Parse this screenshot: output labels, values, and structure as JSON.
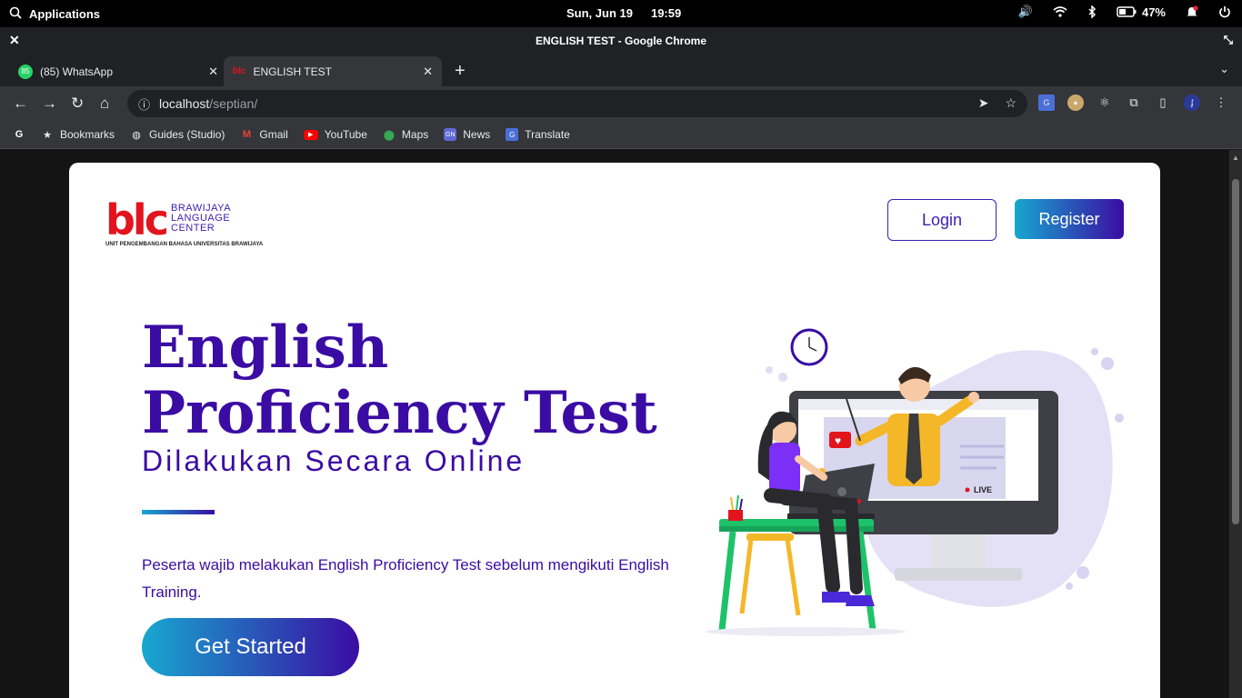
{
  "system_bar": {
    "applications": "Applications",
    "date": "Sun, Jun 19",
    "time": "19:59",
    "battery": "47%"
  },
  "window": {
    "title": "ENGLISH TEST - Google Chrome"
  },
  "tabs": [
    {
      "label": "(85) WhatsApp",
      "badge": "85"
    },
    {
      "label": "ENGLISH TEST",
      "favicon_text": "blc"
    }
  ],
  "address_bar": {
    "host": "localhost",
    "path": "/septian/"
  },
  "bookmarks": [
    {
      "label": "Bookmarks"
    },
    {
      "label": "Guides (Studio)"
    },
    {
      "label": "Gmail"
    },
    {
      "label": "YouTube"
    },
    {
      "label": "Maps"
    },
    {
      "label": "News"
    },
    {
      "label": "Translate"
    }
  ],
  "page": {
    "logo": {
      "mark": "blc",
      "line1": "BRAWIJAYA",
      "line2": "LANGUAGE",
      "line3": "CENTER",
      "subtitle": "UNIT PENGEMBANGAN BAHASA UNIVERSITAS BRAWIJAYA"
    },
    "login_label": "Login",
    "register_label": "Register",
    "headline_line1": "English",
    "headline_line2": "Proficiency Test",
    "subheadline": "Dilakukan Secara Online",
    "description": "Peserta wajib melakukan English Proficiency Test sebelum mengikuti English Training.",
    "cta_label": "Get Started",
    "illustration": {
      "live_label": "LIVE"
    }
  },
  "colors": {
    "brand": "#3a0ca3",
    "accent": "#17a7cf",
    "logo_red": "#e2141e"
  }
}
